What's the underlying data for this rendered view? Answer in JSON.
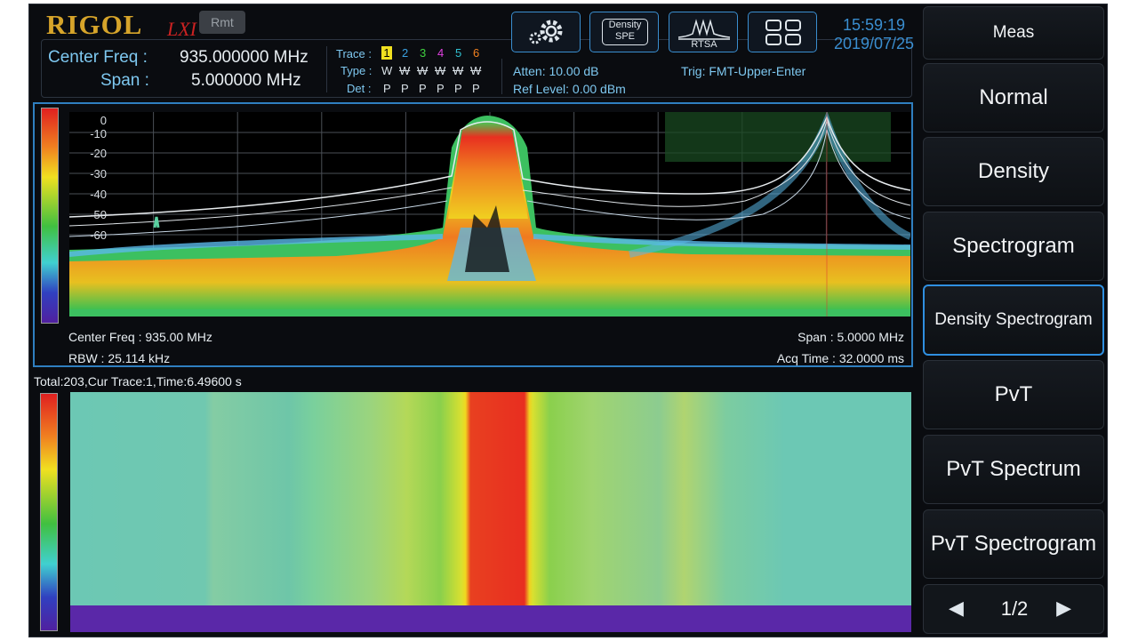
{
  "brand": {
    "logo": "RIGOL",
    "lxi": "LXI",
    "rmt": "Rmt"
  },
  "header": {
    "center_freq_label": "Center Freq :",
    "center_freq_value": "935.000000 MHz",
    "span_label": "Span :",
    "span_value": "5.000000 MHz",
    "trace_label": "Trace :",
    "type_label": "Type :",
    "det_label": "Det :",
    "traces": [
      "1",
      "2",
      "3",
      "4",
      "5",
      "6"
    ],
    "types": [
      "W",
      "W",
      "W",
      "W",
      "W",
      "W"
    ],
    "dets": [
      "P",
      "P",
      "P",
      "P",
      "P",
      "P"
    ],
    "atten": "Atten: 10.00 dB",
    "ref_level": "Ref Level: 0.00 dBm",
    "trig": "Trig: FMT-Upper-Enter",
    "time": "15:59:19",
    "date": "2019/07/25"
  },
  "toolbar": {
    "settings_icon": "gear-icon",
    "density_top": "Density",
    "density_bottom": "SPE",
    "rtsa_label": "RTSA",
    "layout_icon": "grid-icon"
  },
  "plot": {
    "y_ticks": [
      "0",
      "-10",
      "-20",
      "-30",
      "-40",
      "-50",
      "-60"
    ],
    "center_freq_info": "Center Freq : 935.00 MHz",
    "rbw_info": "RBW : 25.114 kHz",
    "span_info": "Span : 5.0000 MHz",
    "acq_info": "Acq Time : 32.0000 ms"
  },
  "spectrogram": {
    "status": "Total:203,Cur Trace:1,Time:6.49600 s"
  },
  "menu": {
    "title": "Meas",
    "items": [
      "Normal",
      "Density",
      "Spectrogram",
      "Density Spectrogram",
      "PvT",
      "PvT Spectrum",
      "PvT Spectrogram"
    ],
    "active": "Density Spectrogram",
    "page": "1/2"
  },
  "colors": {
    "accent": "#2f8fe0",
    "logo": "#d6a42a",
    "trace1": "#f0e020"
  }
}
